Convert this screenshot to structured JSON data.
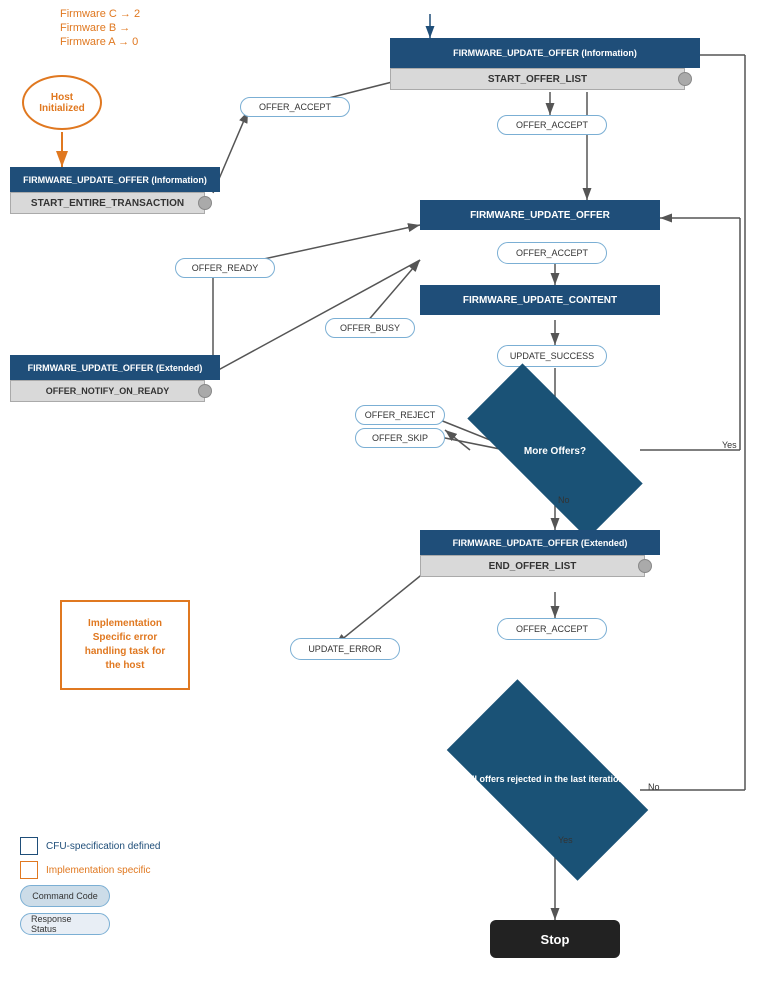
{
  "firmware_labels": [
    "Firmware C → 2",
    "Firmware B →",
    "Firmware A → 0"
  ],
  "host_initialized": "Host\nInitialized",
  "boxes": {
    "start_offer_list_header": "FIRMWARE_UPDATE_OFFER (Information)",
    "start_offer_list_sub": "START_OFFER_LIST",
    "start_entire_header": "FIRMWARE_UPDATE_OFFER (Information)",
    "start_entire_sub": "START_ENTIRE_TRANSACTION",
    "firmware_update_offer": "FIRMWARE_UPDATE_OFFER",
    "firmware_update_content": "FIRMWARE_UPDATE_CONTENT",
    "offer_notify_header": "FIRMWARE_UPDATE_OFFER (Extended)",
    "offer_notify_sub": "OFFER_NOTIFY_ON_READY",
    "end_offer_list_header": "FIRMWARE_UPDATE_OFFER (Extended)",
    "end_offer_list_sub": "END_OFFER_LIST"
  },
  "pills": {
    "offer_accept_1": "OFFER_ACCEPT",
    "offer_accept_2": "OFFER_ACCEPT",
    "offer_accept_3": "OFFER_ACCEPT",
    "offer_accept_4": "OFFER_ACCEPT",
    "offer_ready": "OFFER_READY",
    "offer_busy": "OFFER_BUSY",
    "offer_reject": "OFFER_REJECT",
    "offer_skip": "OFFER_SKIP",
    "update_success": "UPDATE_SUCCESS",
    "update_error": "UPDATE_ERROR"
  },
  "diamonds": {
    "more_offers": "More Offers?",
    "all_rejected": "All offers rejected\nin the last\niteration?"
  },
  "labels": {
    "yes_1": "Yes",
    "no_1": "No",
    "no_2": "No",
    "yes_2": "Yes"
  },
  "impl_box": "Implementation\nSpecific error\nhandling task for\nthe host",
  "stop": "Stop",
  "legend": {
    "cfu_label": "CFU-specification defined",
    "impl_label": "Implementation specific",
    "command_code": "Command Code",
    "response_status": "Response Status"
  }
}
